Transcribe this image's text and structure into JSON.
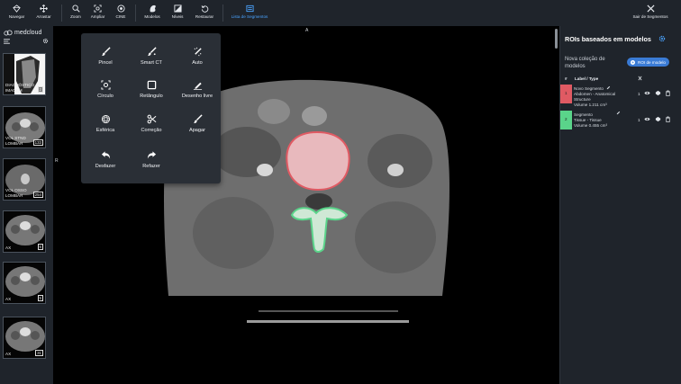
{
  "toolbar": {
    "items": [
      {
        "label": "Navegar",
        "icon": "navigate-icon"
      },
      {
        "label": "Arrastar",
        "icon": "pan-icon"
      },
      {
        "label": "Zoom",
        "icon": "zoom-icon"
      },
      {
        "label": "Ampliar",
        "icon": "magnify-icon"
      },
      {
        "label": "CINE",
        "icon": "cine-icon"
      },
      {
        "label": "Modelos",
        "icon": "models-icon"
      },
      {
        "label": "Níveis",
        "icon": "levels-icon"
      },
      {
        "label": "Restaurar",
        "icon": "reset-icon"
      },
      {
        "label": "Lista de Segmentos",
        "icon": "segment-list-icon"
      },
      {
        "label": "Sair de Segmentos",
        "icon": "close-icon"
      }
    ]
  },
  "brand": {
    "name": "medcloud"
  },
  "series": [
    {
      "label": "DIAGNÓSTICO IMAGEM",
      "count": "2"
    },
    {
      "label": "VOL STND LOMBAR",
      "count": "133"
    },
    {
      "label": "VOL OSSO LOMBAR",
      "count": "254"
    },
    {
      "label": "AX",
      "count": "5"
    },
    {
      "label": "AX",
      "count": "5"
    },
    {
      "label": "AX",
      "count": "31"
    }
  ],
  "viewport": {
    "orientation_top": "A",
    "orientation_left": "R"
  },
  "tool_menu": {
    "items": [
      {
        "label": "Pincel",
        "icon": "brush-icon"
      },
      {
        "label": "Smart CT",
        "icon": "smart-ct-icon"
      },
      {
        "label": "Auto",
        "icon": "auto-icon"
      },
      {
        "label": "Círculo",
        "icon": "circle-icon"
      },
      {
        "label": "Retângulo",
        "icon": "rectangle-icon"
      },
      {
        "label": "Desenho livre",
        "icon": "freehand-icon"
      },
      {
        "label": "Esférica",
        "icon": "sphere-icon"
      },
      {
        "label": "Correção",
        "icon": "scissors-icon"
      },
      {
        "label": "Apagar",
        "icon": "eraser-icon"
      },
      {
        "label": "Desfazer",
        "icon": "undo-icon"
      },
      {
        "label": "Refazer",
        "icon": "redo-icon"
      }
    ]
  },
  "right_panel": {
    "title": "ROIs baseados em modelos",
    "new_collection": "Nova coleção de modelos",
    "roi_button": "ROI de modelo",
    "table_header": {
      "hash": "#",
      "label": "Label / Type"
    },
    "segments": [
      {
        "index": "1",
        "name": "Novo Segmento",
        "type": "Abdomen - Anatomical Structure",
        "volume": "Volume 1.211 cm³",
        "count": "1",
        "color": "#e05a63"
      },
      {
        "index": "2",
        "name": "Segmento",
        "type": "Tissue - Tissue",
        "volume": "Volume 0.455 cm³",
        "count": "1",
        "color": "#5ad48a"
      }
    ]
  }
}
